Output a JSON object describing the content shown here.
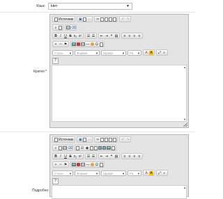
{
  "fields": {
    "image_label": "Язык:",
    "image_value": "Нет",
    "short_label": "Кратко:*",
    "detail_label": "Подробно:"
  },
  "editor": {
    "source_label": "Источник",
    "style_placeholder": "Стиль",
    "format_placeholder": "Формат",
    "font_placeholder": "Шрифт",
    "size_placeholder": "Ра",
    "help": "?"
  },
  "colors": {
    "toolbar_bg": "#e4e4e4",
    "text_color_icon": "#c0392b",
    "bg_color_icon": "#f1c40f"
  }
}
